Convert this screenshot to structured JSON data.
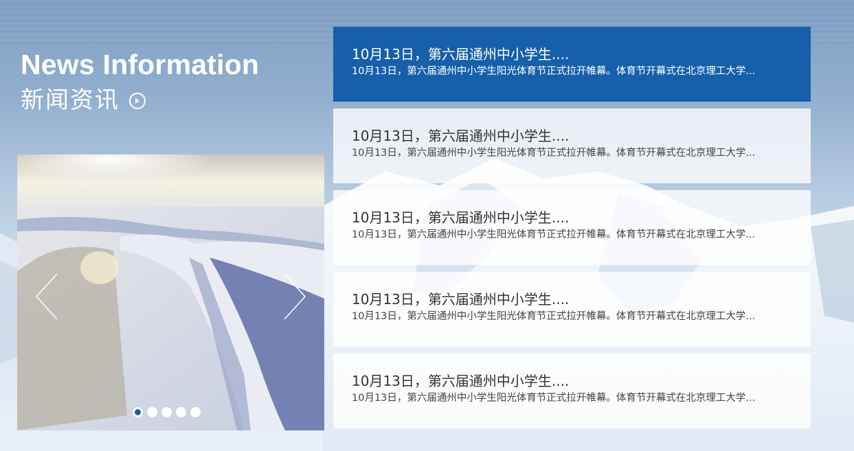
{
  "section": {
    "title_en": "News Information",
    "title_cn": "新闻资讯",
    "more_icon": "circle-chevron-right-icon"
  },
  "carousel": {
    "prev_icon": "chevron-left-icon",
    "next_icon": "chevron-right-icon",
    "dot_count": 5,
    "active_dot": 0,
    "image_subject": "snowy ice field at sunset"
  },
  "news": [
    {
      "title": "10月13日，第六届通州中小学生....",
      "summary": "10月13日，第六届通州中小学生阳光体育节正式拉开帷幕。体育节开幕式在北京理工大学...",
      "active": true
    },
    {
      "title": "10月13日，第六届通州中小学生....",
      "summary": "10月13日，第六届通州中小学生阳光体育节正式拉开帷幕。体育节开幕式在北京理工大学...",
      "active": false
    },
    {
      "title": "10月13日，第六届通州中小学生....",
      "summary": "10月13日，第六届通州中小学生阳光体育节正式拉开帷幕。体育节开幕式在北京理工大学...",
      "active": false
    },
    {
      "title": "10月13日，第六届通州中小学生....",
      "summary": "10月13日，第六届通州中小学生阳光体育节正式拉开帷幕。体育节开幕式在北京理工大学...",
      "active": false
    },
    {
      "title": "10月13日，第六届通州中小学生....",
      "summary": "10月13日，第六届通州中小学生阳光体育节正式拉开帷幕。体育节开幕式在北京理工大学...",
      "active": false
    }
  ],
  "colors": {
    "accent": "#1660ab",
    "text": "#333333",
    "background_top": "#7f9fc4",
    "background_bottom": "#e9f0f8"
  }
}
